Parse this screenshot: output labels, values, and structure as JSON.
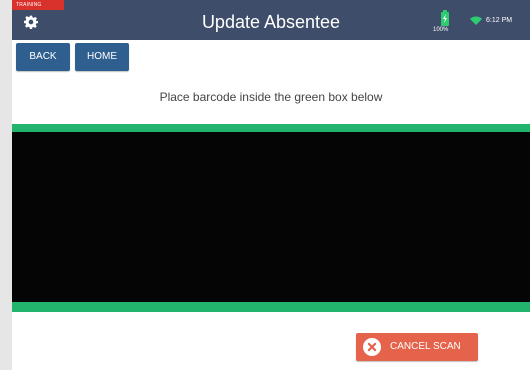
{
  "header": {
    "training_label": "TRAINING",
    "title": "Update Absentee",
    "battery_percent": "100%",
    "time": "6:12 PM"
  },
  "nav": {
    "back_label": "BACK",
    "home_label": "HOME"
  },
  "scanner": {
    "instruction": "Place barcode inside the green box below",
    "cancel_label": "CANCEL SCAN"
  },
  "icons": {
    "settings": "gear-icon",
    "battery": "battery-icon",
    "wifi": "wifi-icon",
    "cancel": "close-circle-icon"
  },
  "colors": {
    "header_bg": "#3e4d69",
    "training_badge": "#d9312b",
    "nav_button": "#2f5f8f",
    "scan_frame": "#22b46d",
    "cancel_button": "#e4634a",
    "status_green": "#2ecc71"
  }
}
